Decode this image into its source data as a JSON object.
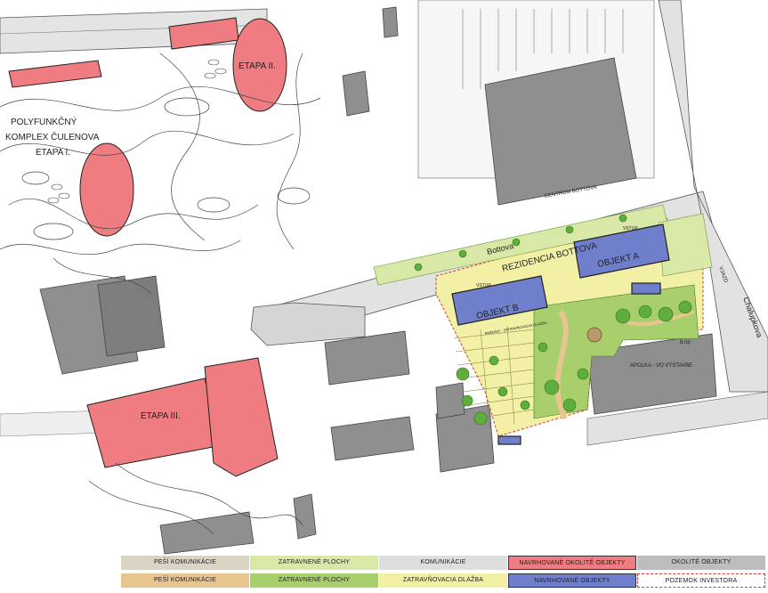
{
  "labels": {
    "etapa_1": "ETAPA I.",
    "etapa_2": "ETAPA II.",
    "etapa_3": "ETAPA III.",
    "complex_line1": "POLYFUNKČNÝ",
    "complex_line2": "KOMPLEX ČULENOVA",
    "bottova": "Bottova",
    "rezidencia": "REZIDENCIA BOTTOVA",
    "objekt_a": "OBJEKT A",
    "objekt_b": "OBJEKT B",
    "centrum": "CENTRUM BOTTOVA",
    "apolka": "APOLKA - VO VÝSTAVBE",
    "floors": "8.np",
    "vstup_a": "VSTUP",
    "vstup_b": "VSTUP",
    "chalupkova": "Chalupkova",
    "vjazd": "VJAZD",
    "parking": "PARKING - ZATRAVŇOVACIA DLAŽBA"
  },
  "legend": [
    {
      "label": "PEŠÍ KOMUNIKÁCIE",
      "color": "#d9d4c3"
    },
    {
      "label": "ZATRAVNENÉ PLOCHY",
      "color": "#d7e8a7"
    },
    {
      "label": "KOMUNIKÁCIE",
      "color": "#dedede"
    },
    {
      "label": "NAVRHOVANÉ OKOLITÉ OBJEKTY",
      "color": "#ee7c80"
    },
    {
      "label": "OKOLITÉ OBJEKTY",
      "color": "#bdbdbd"
    },
    {
      "label": "PEŠÍ KOMUNIKÁCIE",
      "color": "#e8c58f"
    },
    {
      "label": "ZATRAVNENÉ PLOCHY",
      "color": "#a9cf6c"
    },
    {
      "label": "ZATRAVŇOVACIA DLAŽBA",
      "color": "#f1f0a4"
    },
    {
      "label": "NAVRHOVANÉ OBJEKTY",
      "color": "#6f7fcc"
    },
    {
      "label": "POZEMOK INVESTORA",
      "color": "#ffffff"
    }
  ],
  "colors": {
    "proposed_surrounding": "#ee7c80",
    "surrounding": "#8f8f8f",
    "proposed": "#6f7fcc",
    "grass": "#a9cf6c",
    "paving": "#f1f0a4",
    "boundary": "#d23a3a"
  }
}
